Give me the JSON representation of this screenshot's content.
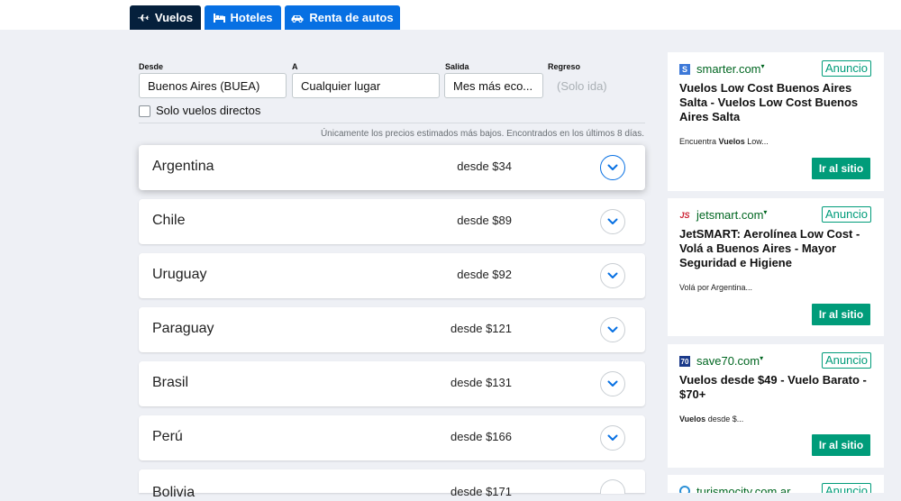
{
  "tabs": [
    {
      "label": "Vuelos",
      "icon": "plane-icon"
    },
    {
      "label": "Hoteles",
      "icon": "bed-icon"
    },
    {
      "label": "Renta de autos",
      "icon": "car-icon"
    }
  ],
  "search": {
    "desde_label": "Desde",
    "desde_value": "Buenos Aires (BUEA)",
    "a_label": "A",
    "a_value": "Cualquier lugar",
    "salida_label": "Salida",
    "salida_value": "Mes más eco...",
    "regreso_label": "Regreso",
    "regreso_placeholder": "(Solo ida)",
    "direct_label": "Solo vuelos directos",
    "direct_checked": false
  },
  "note": "Únicamente los precios estimados más bajos. Encontrados en los últimos 8 días.",
  "destinations": [
    {
      "name": "Argentina",
      "price": "desde $34"
    },
    {
      "name": "Chile",
      "price": "desde $89"
    },
    {
      "name": "Uruguay",
      "price": "desde $92"
    },
    {
      "name": "Paraguay",
      "price": "desde $121"
    },
    {
      "name": "Brasil",
      "price": "desde $131"
    },
    {
      "name": "Perú",
      "price": "desde $166"
    },
    {
      "name": "Bolivia",
      "price": "desde $171"
    }
  ],
  "ads": [
    {
      "domain": "smarter.com",
      "tag": "Anuncio",
      "title": "Vuelos Low Cost Buenos Aires Salta - Vuelos Low Cost Buenos Aires Salta",
      "desc_pre": "Encuentra ",
      "desc_bold": "Vuelos",
      "desc_post": " Low...",
      "button": "Ir al sitio",
      "icon_text": "S",
      "icon_color": "#3c78d8"
    },
    {
      "domain": "jetsmart.com",
      "tag": "Anuncio",
      "title": "JetSMART: Aerolínea Low Cost - Volá a Buenos Aires - Mayor Seguridad e Higiene",
      "desc_pre": "Volá por Argentina...",
      "desc_bold": "",
      "desc_post": "",
      "button": "Ir al sitio",
      "icon_text": "JS",
      "icon_color": "#cc2233"
    },
    {
      "domain": "save70.com",
      "tag": "Anuncio",
      "title": "Vuelos desde $49 - Vuelo Barato - $70+",
      "desc_pre": "",
      "desc_bold": "Vuelos",
      "desc_post": " desde $...",
      "button": "Ir al sitio",
      "icon_text": "70",
      "icon_color": "#1b3a8a"
    },
    {
      "domain": "turismocity.com.ar",
      "tag": "Anuncio",
      "title": "",
      "desc_pre": "",
      "desc_bold": "",
      "desc_post": "",
      "button": "",
      "icon_text": "",
      "icon_color": "#2a8fd6"
    }
  ],
  "colors": {
    "nav_dark": "#05203c",
    "nav_blue": "#0770e3",
    "ad_green": "#009c7a",
    "page_bg": "#eef0f5"
  }
}
